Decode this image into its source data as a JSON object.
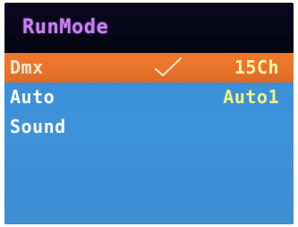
{
  "screen": {
    "title": "RunMode"
  },
  "menu": {
    "items": [
      {
        "label": "Dmx",
        "value": "15Ch",
        "selected": true,
        "checked": true
      },
      {
        "label": "Auto",
        "value": "Auto1",
        "selected": false,
        "checked": false
      },
      {
        "label": "Sound",
        "value": "",
        "selected": false,
        "checked": false
      }
    ]
  },
  "icons": {
    "check": "checkmark-icon"
  },
  "colors": {
    "title": "#c87ff5",
    "background_blue": "#3d92da",
    "highlight_orange": "#e8722a",
    "value_yellow": "#f5f27a"
  }
}
